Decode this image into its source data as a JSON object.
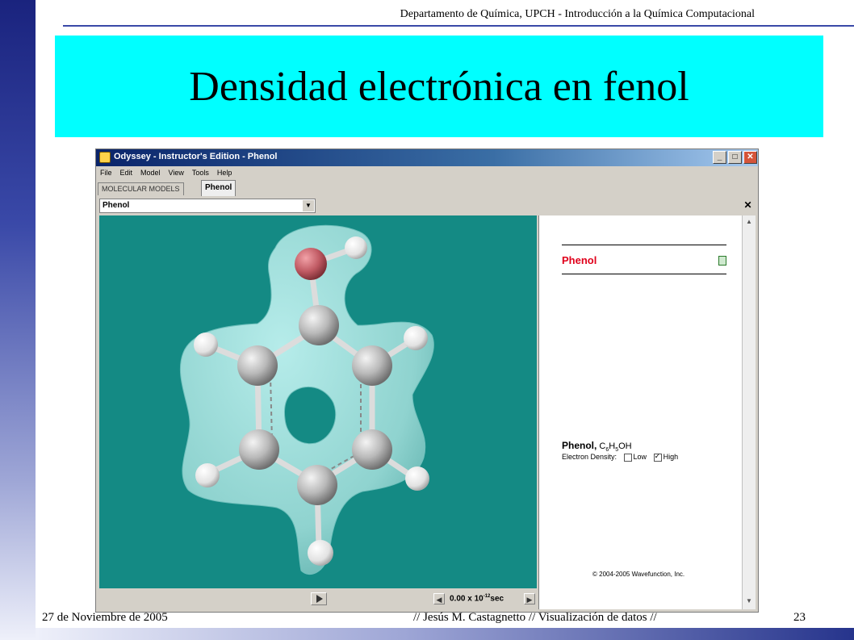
{
  "slide": {
    "header": "Departamento de Química, UPCH - Introducción a la Química Computacional",
    "title": "Densidad electrónica en fenol",
    "footer_date": "27 de Noviembre de 2005",
    "footer_author": "// Jesús M. Castagnetto // Visualización de datos //",
    "page_number": "23"
  },
  "app": {
    "window_title": "Odyssey - Instructor's Edition - Phenol",
    "window_buttons": {
      "minimize": "_",
      "maximize": "□",
      "close": "✕"
    },
    "menu": [
      "File",
      "Edit",
      "Model",
      "View",
      "Tools",
      "Help"
    ],
    "tabs": [
      {
        "label": "MOLECULAR MODELS",
        "active": false
      },
      {
        "label": "Phenol",
        "active": true
      }
    ],
    "molecule_select": {
      "value": "Phenol"
    },
    "panel_close": "✕",
    "info": {
      "title": "Phenol",
      "formula_name": "Phenol,",
      "formula_c": "C",
      "formula_c_sub": "6",
      "formula_h": "H",
      "formula_h_sub": "5",
      "formula_tail": "OH",
      "density_label": "Electron Density:",
      "option_low": "Low",
      "option_low_checked": false,
      "option_high": "High",
      "option_high_checked": true,
      "copyright": "© 2004-2005 Wavefunction, Inc."
    },
    "time": {
      "value": "0.00 x 10",
      "exponent": "-12",
      "unit": "sec"
    },
    "colors": {
      "viewer_bg": "#148a84",
      "isosurface": "#8fd3cf",
      "carbon": "#b8b8b8",
      "oxygen": "#c05a63",
      "hydrogen": "#f2f2f2",
      "title_box": "#00ffff"
    }
  }
}
